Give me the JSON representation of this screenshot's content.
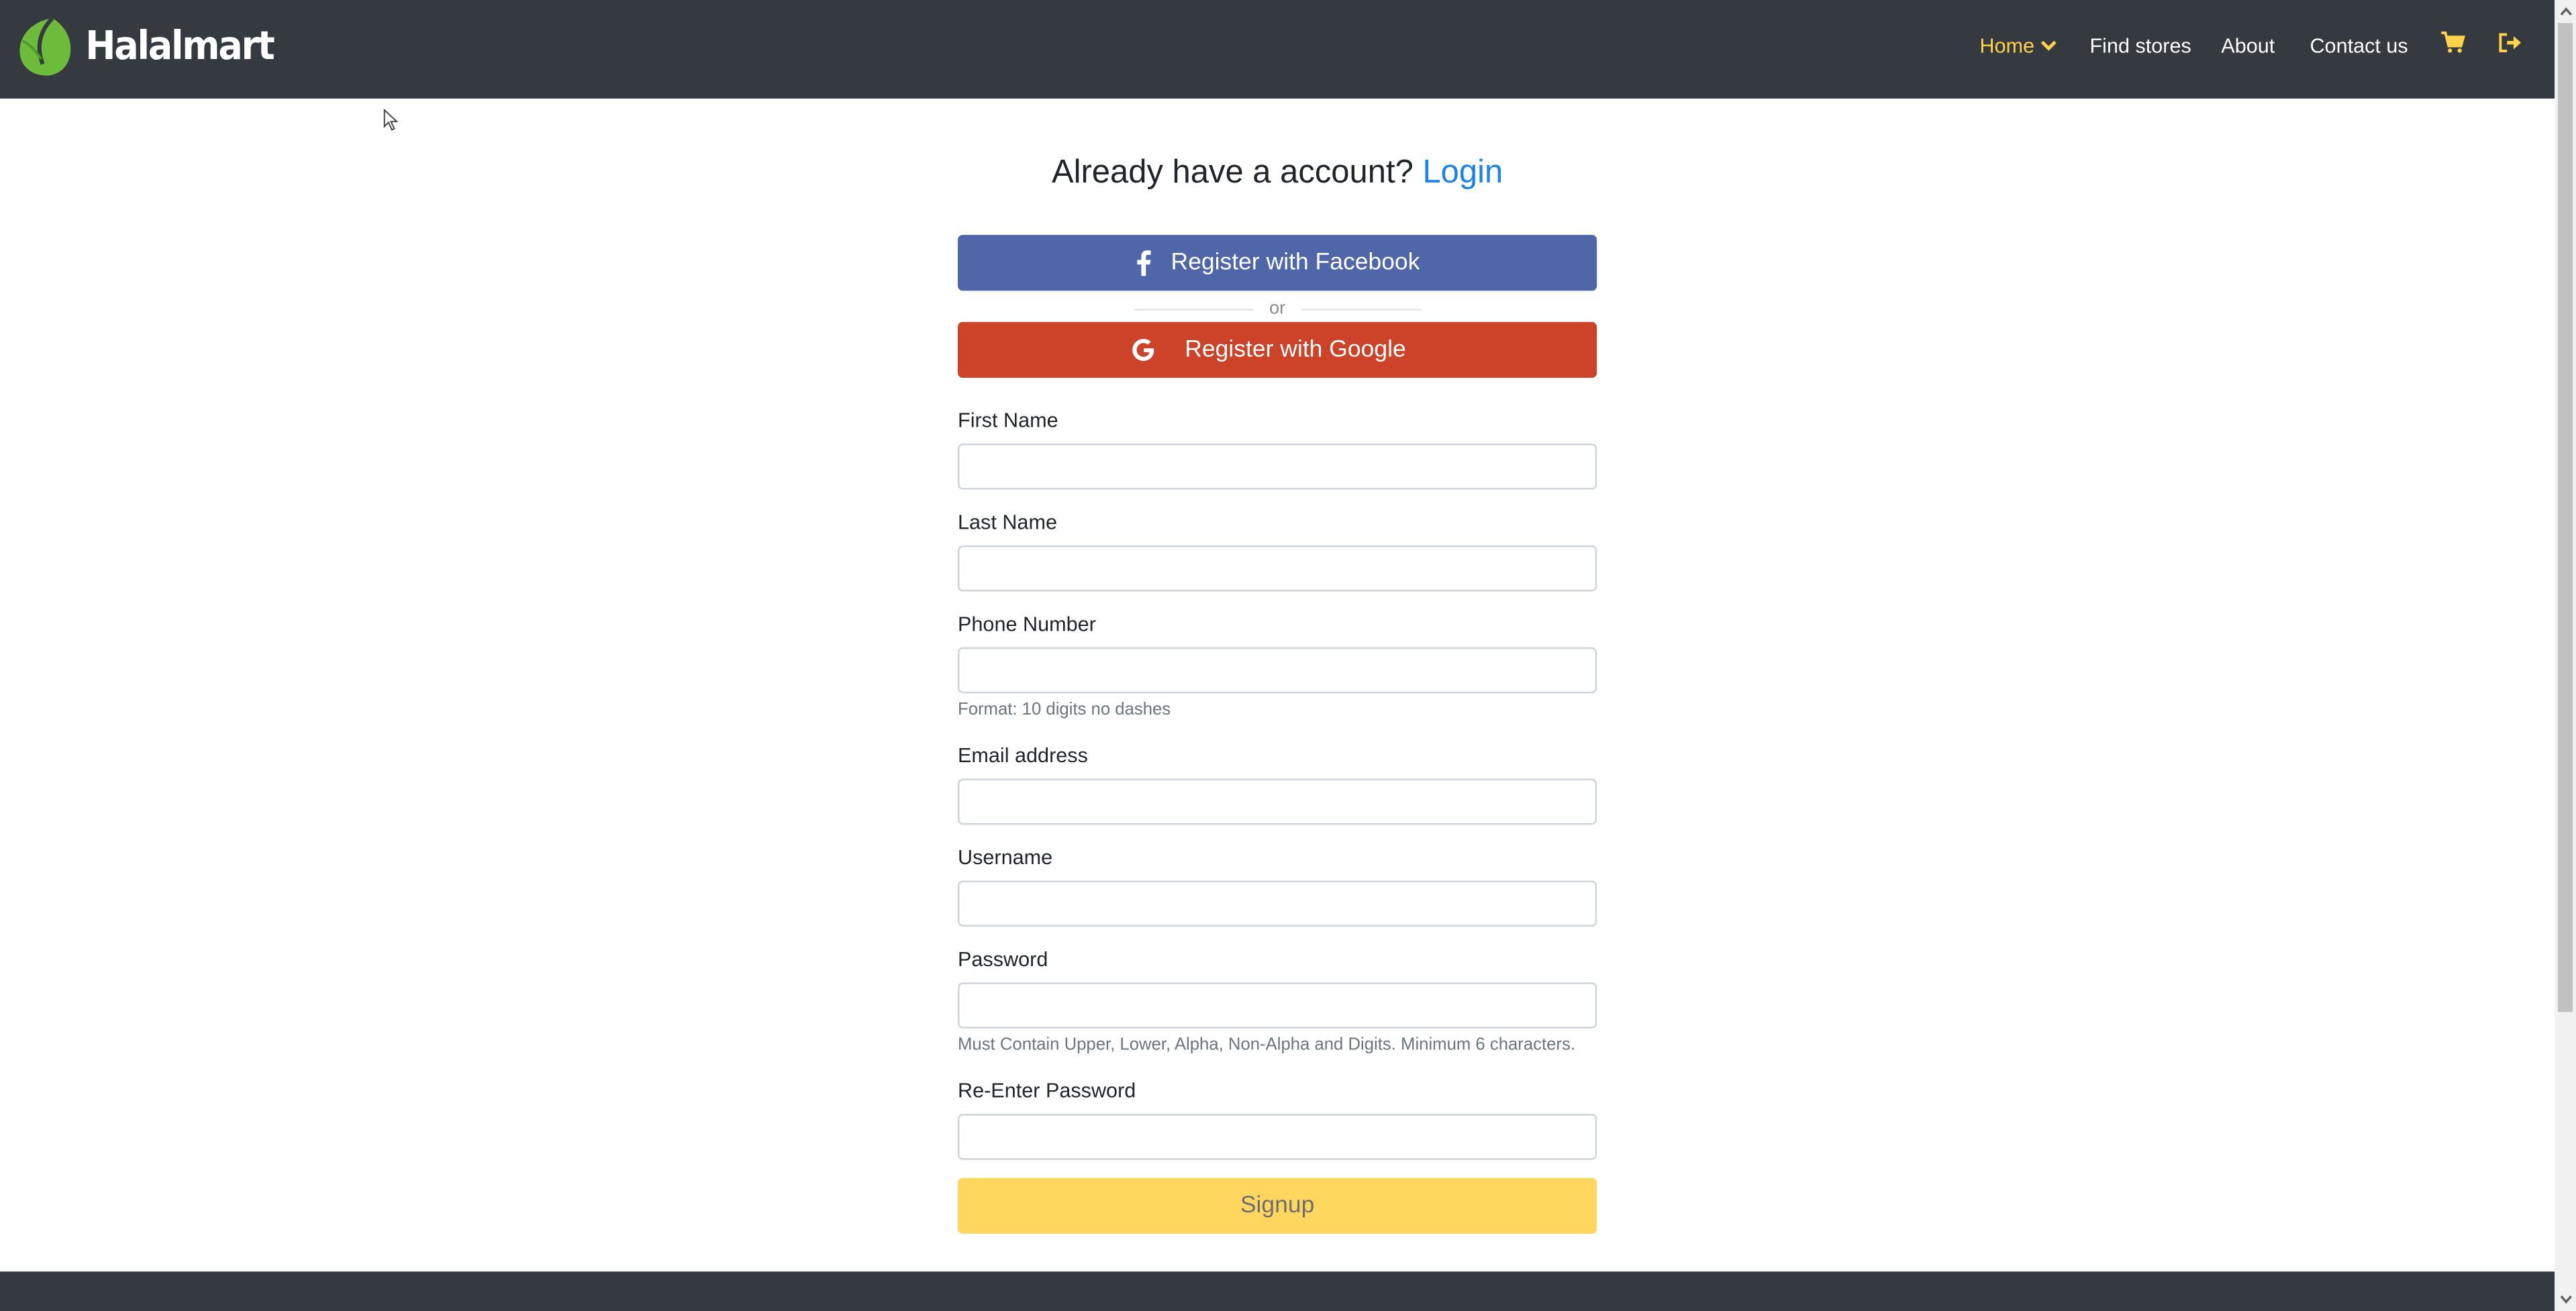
{
  "brand": {
    "name": "Halalmart",
    "logo_icon": "leaf-logo",
    "logo_color": "#6dbb3a"
  },
  "nav": {
    "items": [
      {
        "label": "Home",
        "active": true,
        "icon": "chevron-down-icon"
      },
      {
        "label": "Find stores"
      },
      {
        "label": "About"
      },
      {
        "label": "Contact us"
      }
    ],
    "icons": [
      "cart-icon",
      "sign-out-icon"
    ],
    "active_color": "#ffd24a"
  },
  "page": {
    "headline": "Already have a account?",
    "login_link": "Login"
  },
  "social": {
    "facebook_label": "Register with Facebook",
    "facebook_color": "#4f67a9",
    "or_text": "or",
    "google_label": "Register with Google",
    "google_color": "#cc4329"
  },
  "form": {
    "fields": [
      {
        "label": "First Name",
        "value": "",
        "help": ""
      },
      {
        "label": "Last Name",
        "value": "",
        "help": ""
      },
      {
        "label": "Phone Number",
        "value": "",
        "help": "Format: 10 digits no dashes"
      },
      {
        "label": "Email address",
        "value": "",
        "help": ""
      },
      {
        "label": "Username",
        "value": "",
        "help": ""
      },
      {
        "label": "Password",
        "value": "",
        "help": "Must Contain Upper, Lower, Alpha, Non-Alpha and Digits. Minimum 6 characters."
      },
      {
        "label": "Re-Enter Password",
        "value": "",
        "help": ""
      }
    ],
    "submit_label": "Signup",
    "submit_color": "#ffd75e"
  }
}
